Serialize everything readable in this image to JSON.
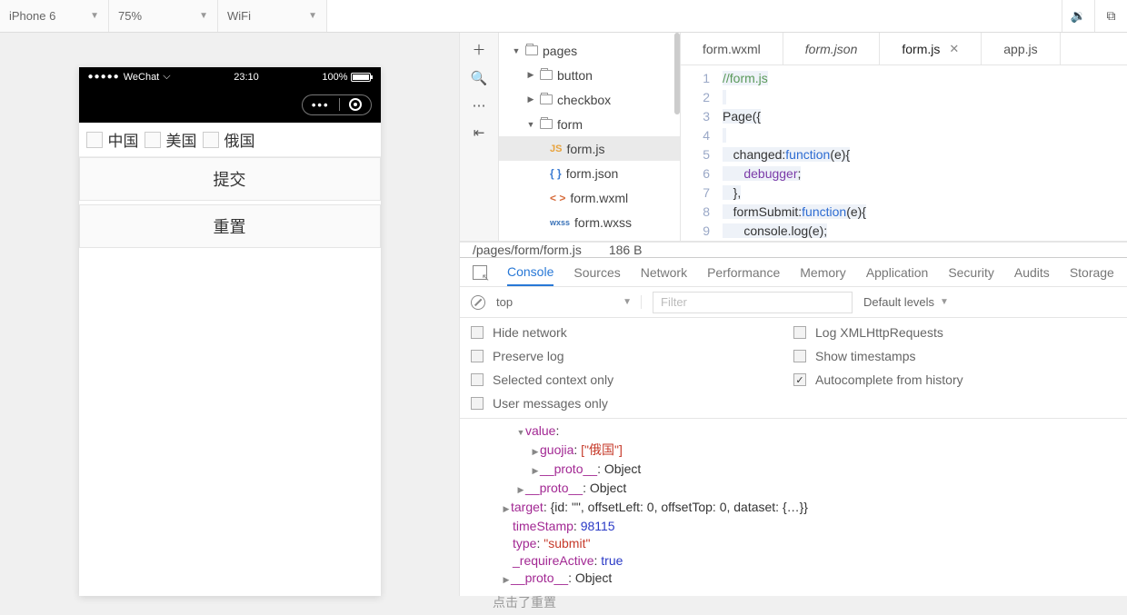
{
  "toolbar": {
    "device": "iPhone 6",
    "zoom": "75%",
    "network": "WiFi"
  },
  "phone": {
    "carrier": "WeChat",
    "time": "23:10",
    "battery": "100%",
    "checkboxes": [
      "中国",
      "美国",
      "俄国"
    ],
    "submit_label": "提交",
    "reset_label": "重置"
  },
  "tree": {
    "root": "pages",
    "items": [
      {
        "label": "button",
        "type": "folder",
        "indent": 30
      },
      {
        "label": "checkbox",
        "type": "folder",
        "indent": 30
      },
      {
        "label": "form",
        "type": "folder-open",
        "indent": 30
      },
      {
        "label": "form.js",
        "type": "js",
        "indent": 56,
        "selected": true
      },
      {
        "label": "form.json",
        "type": "json",
        "indent": 56
      },
      {
        "label": "form.wxml",
        "type": "wxml",
        "indent": 56
      },
      {
        "label": "form.wxss",
        "type": "wxss",
        "indent": 56
      }
    ]
  },
  "editor": {
    "tabs": [
      {
        "label": "form.wxml",
        "active": false
      },
      {
        "label": "form.json",
        "active": false,
        "italic": true
      },
      {
        "label": "form.js",
        "active": true,
        "closable": true
      },
      {
        "label": "app.js",
        "active": false
      }
    ],
    "status_path": "/pages/form/form.js",
    "status_size": "186 B",
    "gutter": [
      "1",
      "2",
      "3",
      "4",
      "5",
      "6",
      "7",
      "8",
      "9"
    ]
  },
  "code": {
    "l1_comment": "//form.js",
    "l3_page": "Page",
    "l3_open": "({",
    "l5_changed": "changed:",
    "l5_function": "function",
    "l5_sig": "(e){",
    "l6_debugger": "debugger",
    "l6_semi": ";",
    "l7_close": "},",
    "l8_formSubmit": "formSubmit:",
    "l8_function": "function",
    "l8_sig": "(e){",
    "l9_console": "console.log(e);"
  },
  "devtools": {
    "tabs": [
      "Console",
      "Sources",
      "Network",
      "Performance",
      "Memory",
      "Application",
      "Security",
      "Audits",
      "Storage"
    ],
    "context": "top",
    "filter_placeholder": "Filter",
    "levels": "Default levels",
    "opts_left": [
      "Hide network",
      "Preserve log",
      "Selected context only",
      "User messages only"
    ],
    "opts_right": [
      {
        "label": "Log XMLHttpRequests",
        "checked": false
      },
      {
        "label": "Show timestamps",
        "checked": false
      },
      {
        "label": "Autocomplete from history",
        "checked": true
      }
    ]
  },
  "console": {
    "value_key": "value",
    "guojia_key": "guojia",
    "guojia_val": "[\"俄国\"]",
    "proto": "__proto__",
    "object": "Object",
    "target_key": "target",
    "target_val": "{id: \"\", offsetLeft: 0, offsetTop: 0, dataset: {…}}",
    "timeStamp_key": "timeStamp",
    "timeStamp_val": "98115",
    "type_key": "type",
    "type_val": "\"submit\"",
    "requireActive_key": "_requireActive",
    "requireActive_val": "true",
    "plain_msg": "点击了重置"
  }
}
